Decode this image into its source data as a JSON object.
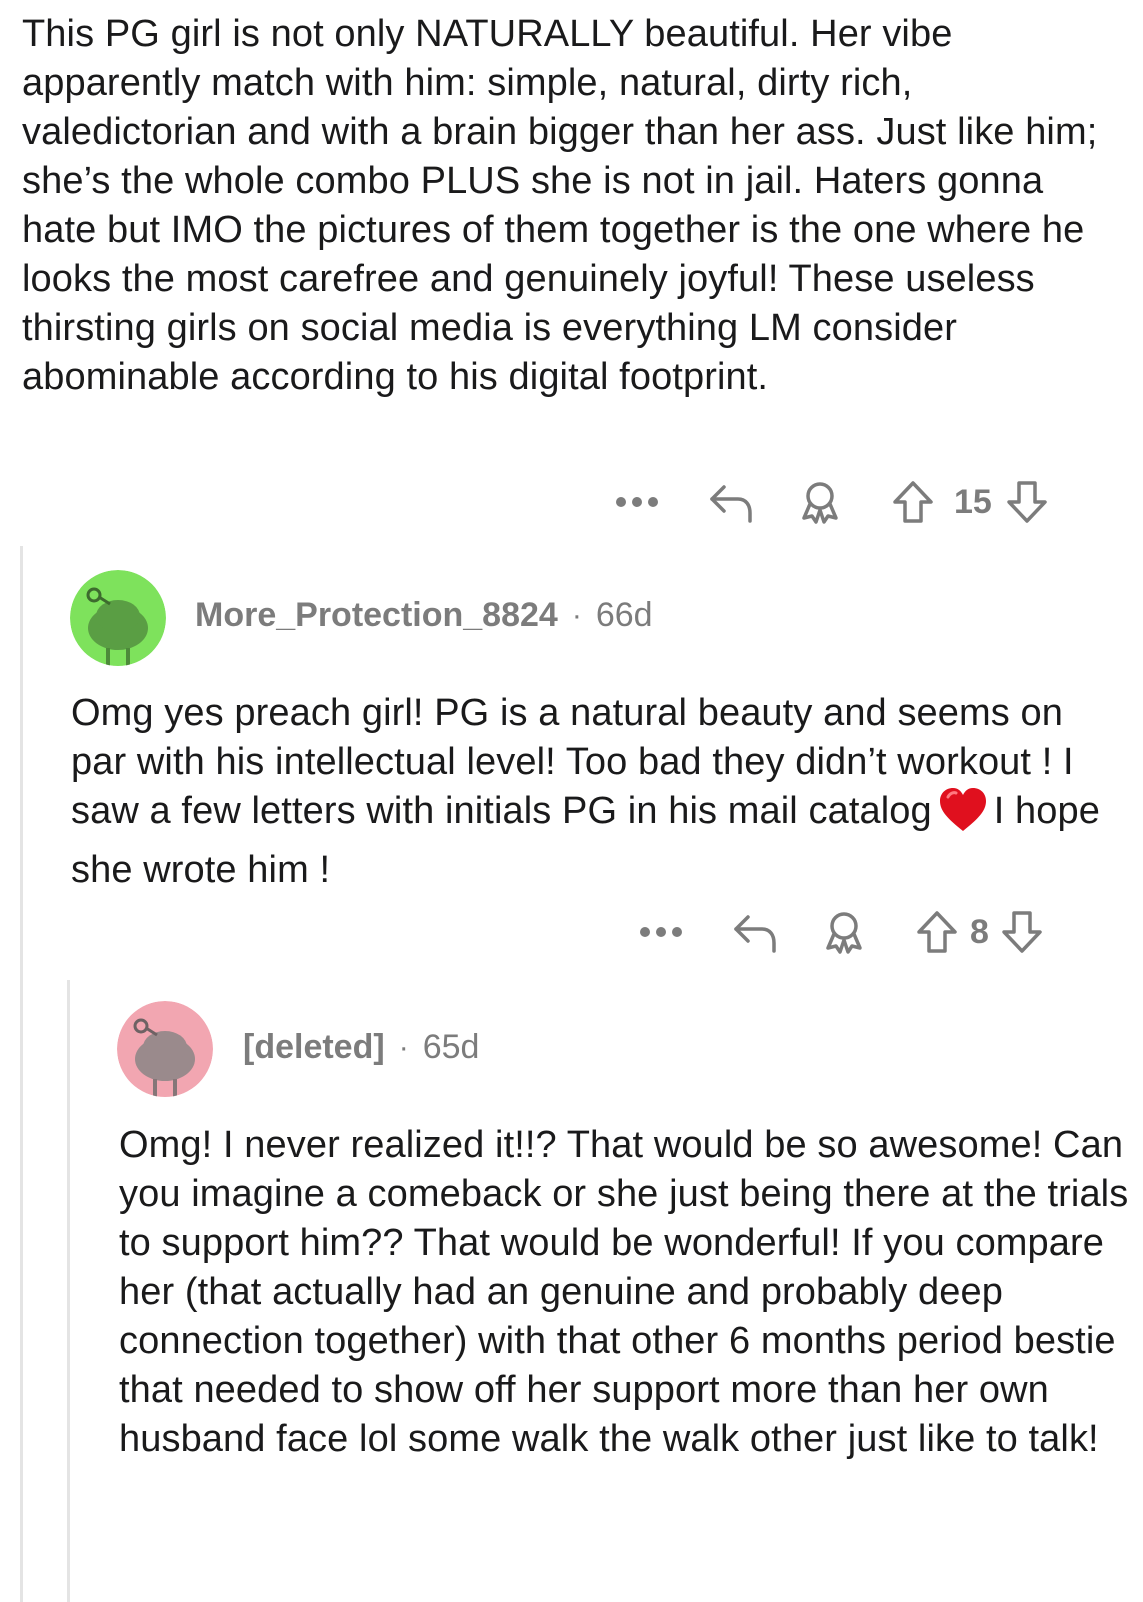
{
  "top_comment": {
    "body": "This PG girl is not only NATURALLY beautiful. Her vibe apparently match with him: simple, natural, dirty rich, valedictorian and with a brain bigger than her ass. Just like him; she’s the whole combo PLUS she is not in jail. Haters gonna hate but IMO the pictures of them together is the one where he looks the most carefree and genuinely joyful! These useless thirsting girls on social media is everything LM consider abominable according to his digital footprint.",
    "vote_count": "15"
  },
  "reply1": {
    "username": "More_Protection_8824",
    "separator": "·",
    "age": "66d",
    "avatar_color": "#7ee25c",
    "body_part1": "Omg yes preach girl! PG is a natural beauty and seems on par with his intellectual level! Too bad they didn’t workout ! I saw a few letters with initials PG in his mail catalog",
    "body_part2": "I hope she wrote him !",
    "vote_count": "8"
  },
  "reply2": {
    "username": "[deleted]",
    "separator": "·",
    "age": "65d",
    "avatar_color": "#f2a6b1",
    "body": "Omg! I never realized it!!? That would be so awesome! Can you imagine a comeback or she just being there at the trials to support him?? That would be wonderful! If you compare her (that actually had an genuine and probably deep connection together) with that other 6 months period bestie that needed to show off her support more than her own husband face lol some walk the walk other just like to talk!"
  },
  "icons": {
    "more": "more-dots-icon",
    "reply": "reply-arrow-icon",
    "award": "award-icon",
    "upvote": "upvote-arrow-icon",
    "downvote": "downvote-arrow-icon",
    "heart": "red-heart-emoji",
    "avatar": "snoo-avatar-icon"
  },
  "colors": {
    "text": "#1a1a1b",
    "meta": "#7c7c7c",
    "thread_line": "#e4e4e4",
    "heart": "#e0101e"
  }
}
